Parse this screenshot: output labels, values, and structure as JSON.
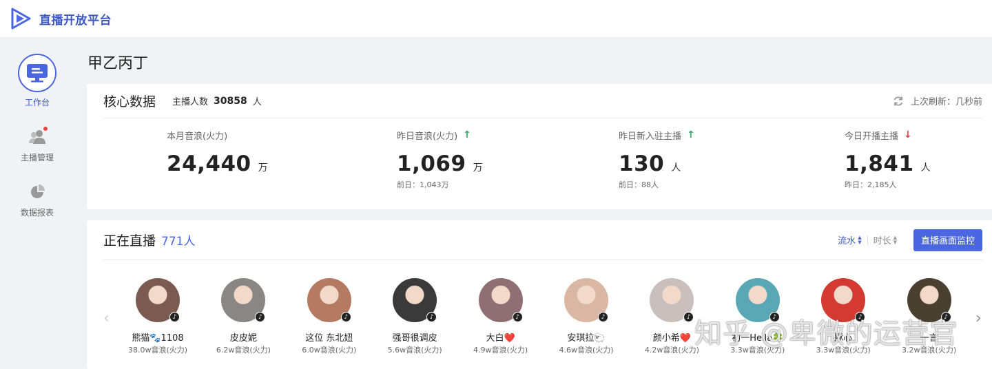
{
  "app": {
    "brand": "直播开放平台",
    "colors": {
      "accent": "#4a67e0",
      "up": "#2dac5c",
      "down": "#e8413f"
    }
  },
  "sidebar": {
    "items": [
      {
        "label": "工作台",
        "icon": "monitor-icon",
        "active": true
      },
      {
        "label": "主播管理",
        "icon": "users-icon",
        "badge": true
      },
      {
        "label": "数据报表",
        "icon": "pie-chart-icon"
      }
    ]
  },
  "page": {
    "title": "甲乙丙丁"
  },
  "core": {
    "title": "核心数据",
    "anchor_label": "主播人数",
    "anchor_count": "30858",
    "anchor_unit": "人",
    "refresh_label": "上次刷新：几秒前",
    "stats": [
      {
        "label": "本月音浪(火力)",
        "value": "24,440",
        "unit": "万",
        "sub": ""
      },
      {
        "label": "昨日音浪(火力)",
        "trend": "up",
        "arrow": "↑",
        "value": "1,069",
        "unit": "万",
        "sub": "前日：1,043万"
      },
      {
        "label": "昨日新入驻主播",
        "trend": "up",
        "arrow": "↑",
        "value": "130",
        "unit": "人",
        "sub": "前日：88人"
      },
      {
        "label": "今日开播主播",
        "trend": "down",
        "arrow": "↓",
        "value": "1,841",
        "unit": "人",
        "sub": "昨日：2,185人"
      }
    ]
  },
  "live": {
    "title": "正在直播",
    "count": "771人",
    "sort_flow": "流水",
    "sort_duration": "时长",
    "monitor_button": "直播画面监控",
    "prev_arrow": "‹",
    "next_arrow": "›",
    "streamers": [
      {
        "name": "熊猫🐾1108",
        "stat": "38.0w音浪(火力)",
        "color": "#7b5a52"
      },
      {
        "name": "皮皮妮",
        "stat": "6.2w音浪(火力)",
        "color": "#8a8686"
      },
      {
        "name": "这位 东北妞",
        "stat": "6.0w音浪(火力)",
        "color": "#b47b62"
      },
      {
        "name": "强哥很调皮",
        "stat": "5.6w音浪(火力)",
        "color": "#3a3a3a"
      },
      {
        "name": "大白❤️",
        "stat": "4.9w音浪(火力)",
        "color": "#8f6f73"
      },
      {
        "name": "安琪拉🐑",
        "stat": "4.6w音浪(火力)",
        "color": "#d9b7a4"
      },
      {
        "name": "颜小希❤️",
        "stat": "4.2w音浪(火力)",
        "color": "#c9c0bd"
      },
      {
        "name": "初一Hella🍀",
        "stat": "3.3w音浪(火力)",
        "color": "#5aa8b5"
      },
      {
        "name": "豚心",
        "stat": "3.3w音浪(火力)",
        "color": "#d23a32"
      },
      {
        "name": "一言",
        "stat": "3.2w音浪(火力)",
        "color": "#4a4032"
      }
    ]
  },
  "watermark": "知乎 @卑微的运营官"
}
